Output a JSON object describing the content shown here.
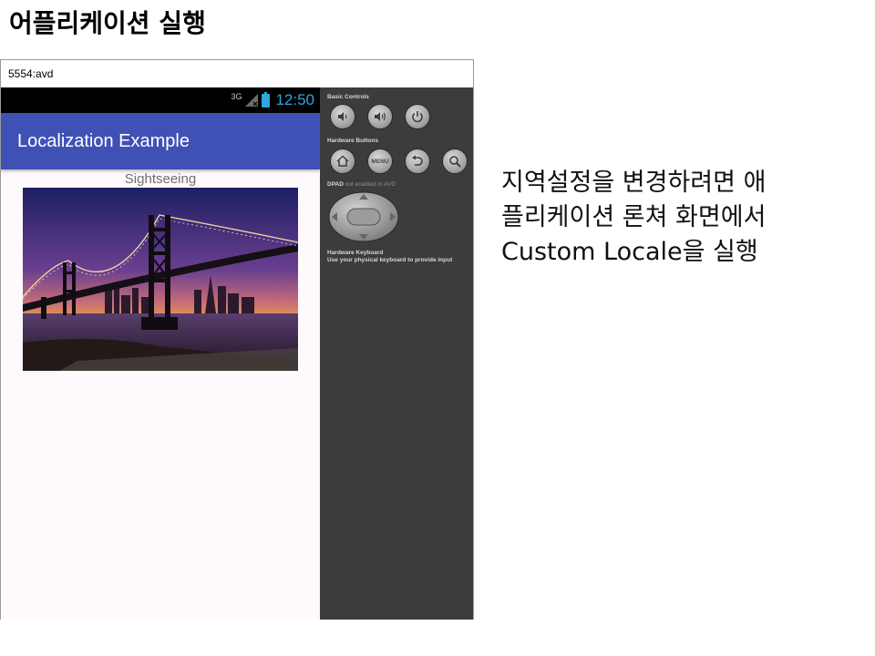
{
  "slide": {
    "title": "어플리케이션 실행",
    "note_lines": [
      "지역설정을 변경하려면 애",
      "플리케이션 론쳐 화면에서",
      "Custom Locale을 실행"
    ]
  },
  "emulator": {
    "window_title": "5554:avd",
    "status_bar": {
      "network": "3G",
      "time": "12:50"
    },
    "app": {
      "title": "Localization Example",
      "caption": "Sightseeing"
    },
    "controls": {
      "basic_controls_label": "Basic Controls",
      "hardware_buttons_label": "Hardware Buttons",
      "menu_label": "MENU",
      "dpad_label": "DPAD",
      "dpad_status": "not enabled in AVD",
      "hardware_keyboard_label": "Hardware Keyboard",
      "keyboard_hint": "Use your physical keyboard to provide input"
    }
  },
  "colors": {
    "app_bar": "#3f51b5",
    "status_accent": "#2ea7df",
    "controls_panel": "#3c3c3c"
  }
}
